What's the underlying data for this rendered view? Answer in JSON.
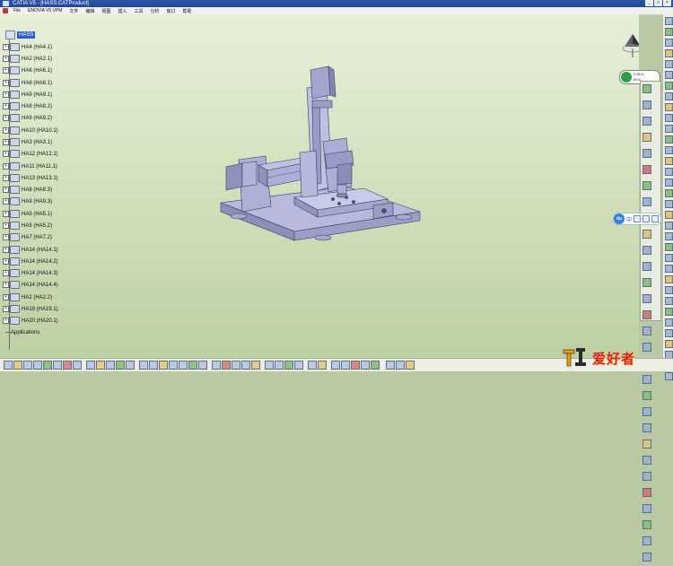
{
  "window": {
    "title": "CATIA V5 - [HASS.CATProduct]",
    "controls": [
      "_",
      "□",
      "×"
    ]
  },
  "menubar": {
    "items": [
      "File",
      "ENOVIA V5 VPM",
      "文件",
      "编辑",
      "视图",
      "插入",
      "工具",
      "分析",
      "窗口",
      "帮助"
    ]
  },
  "tree": {
    "root": "HASS",
    "items": [
      "HA4 (HA4.1)",
      "HA2 (HA2.1)",
      "HA6 (HA6.1)",
      "HA8 (HA8.1)",
      "HA9 (HA9.1)",
      "HA8 (HA8.2)",
      "HA9 (HA9.2)",
      "HA10 (HA10.1)",
      "HA3 (HA3.1)",
      "HA12 (HA12.1)",
      "HA11 (HA11.1)",
      "HA13 (HA13.1)",
      "HA8 (HA8.3)",
      "HA9 (HA9.3)",
      "HA5 (HA5.1)",
      "HA5 (HA5.2)",
      "HA7 (HA7.2)",
      "HA14 (HA14.1)",
      "HA14 (HA14.2)",
      "HA14 (HA14.3)",
      "HA14 (HA14.4)",
      "HA2 (HA2.2)",
      "HA19 (HA19.1)",
      "HA20 (HA20.1)",
      "Applications"
    ]
  },
  "status_badge": {
    "line1": "0.5K/s",
    "line2": "0K/s"
  },
  "ime": {
    "logo": "du",
    "language": "中"
  },
  "watermark": {
    "text": "爱好者",
    "icon_text": "木工"
  },
  "axis_label": "x"
}
